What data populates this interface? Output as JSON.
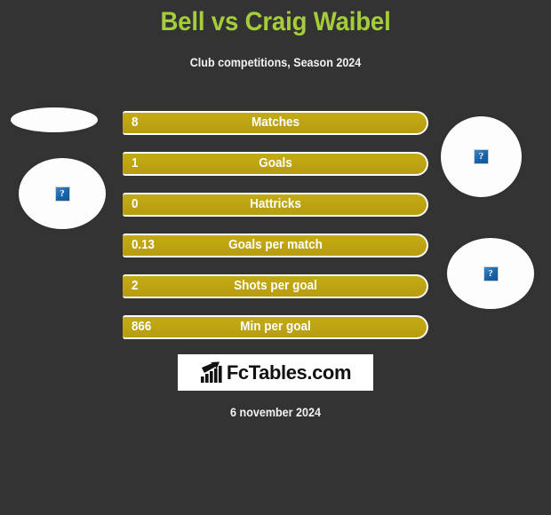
{
  "header": {
    "title": "Bell vs Craig Waibel",
    "subtitle": "Club competitions, Season 2024",
    "title_color": "#a5cd39"
  },
  "background_color": "#333333",
  "bar_color": "#bfa312",
  "stats": [
    {
      "label": "Matches",
      "value": "8",
      "bar_width_pct": 100
    },
    {
      "label": "Goals",
      "value": "1",
      "bar_width_pct": 100
    },
    {
      "label": "Hattricks",
      "value": "0",
      "bar_width_pct": 100
    },
    {
      "label": "Goals per match",
      "value": "0.13",
      "bar_width_pct": 100
    },
    {
      "label": "Shots per goal",
      "value": "2",
      "bar_width_pct": 100
    },
    {
      "label": "Min per goal",
      "value": "866",
      "bar_width_pct": 100
    }
  ],
  "photos": {
    "home_top": {
      "icon": "broken-image-icon",
      "glyph": "?"
    },
    "home_main": {
      "icon": "broken-image-icon",
      "glyph": "?"
    },
    "away_top": {
      "icon": "broken-image-icon",
      "glyph": "?"
    },
    "away_main": {
      "icon": "broken-image-icon",
      "glyph": "?"
    }
  },
  "logo": {
    "text": "FcTables.com",
    "icon": "bar-chart-growth-icon"
  },
  "footer": {
    "date": "6 november 2024"
  },
  "chart_data": {
    "type": "bar",
    "title": "Bell vs Craig Waibel",
    "subtitle": "Club competitions, Season 2024",
    "categories": [
      "Matches",
      "Goals",
      "Hattricks",
      "Goals per match",
      "Shots per goal",
      "Min per goal"
    ],
    "values": [
      8,
      1,
      0,
      0.13,
      2,
      866
    ],
    "value_labels": [
      "8",
      "1",
      "0",
      "0.13",
      "2",
      "866"
    ],
    "xlabel": "",
    "ylabel": "",
    "grid": false,
    "legend": "none",
    "orientation": "horizontal"
  }
}
